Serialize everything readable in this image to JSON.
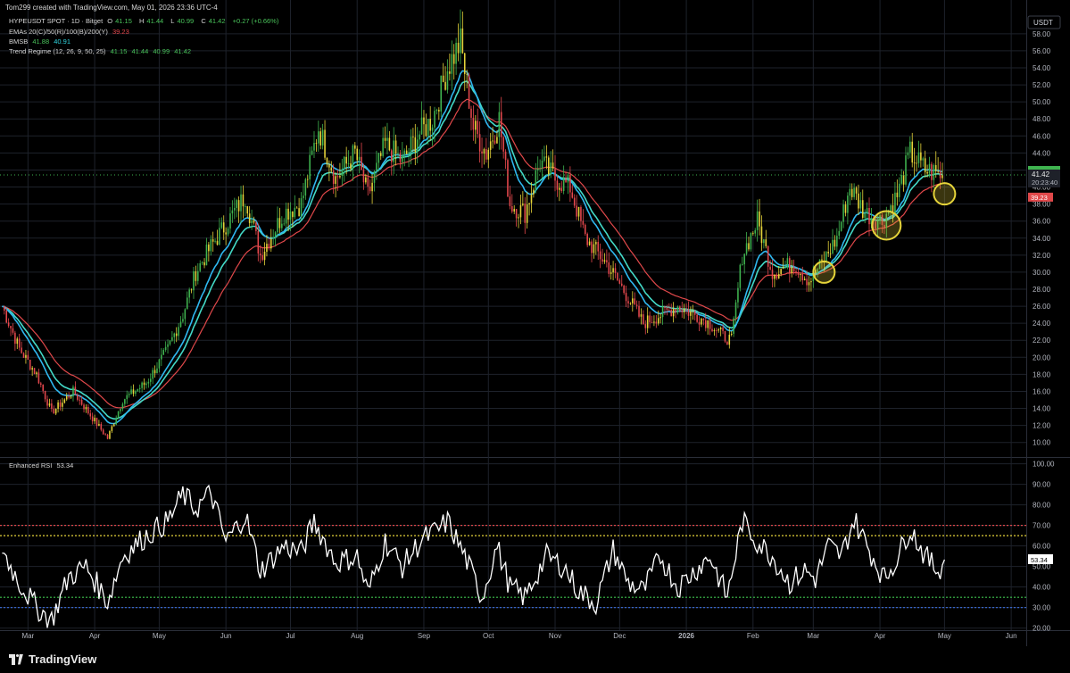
{
  "header": {
    "attribution": "Tom299 created with TradingView.com, May 01, 2026 23:36 UTC-4"
  },
  "legend": {
    "symbol": "HYPEUSDT SPOT · 1D · Bitget",
    "o_label": "O",
    "o": "41.15",
    "h_label": "H",
    "h": "41.44",
    "l_label": "L",
    "l": "40.99",
    "c_label": "C",
    "c": "41.42",
    "change": "+0.27 (+0.66%)",
    "emas_label": "EMAs 20(C)/50(R)/100(B)/200(Y)",
    "emas_value": "39.23",
    "bmsb_label": "BMSB",
    "bmsb_v1": "41.88",
    "bmsb_v2": "40.91",
    "trend_label": "Trend Regime (12, 26, 9, 50, 25)",
    "trend_v1": "41.15",
    "trend_v2": "41.44",
    "trend_v3": "40.99",
    "trend_v4": "41.42",
    "rsi_label": "Enhanced RSI",
    "rsi_value": "53.34"
  },
  "footer": {
    "brand": "TradingView"
  },
  "chart_data": [
    {
      "type": "candlestick",
      "title": "HYPEUSDT SPOT · 1D · Bitget",
      "currency": "USDT",
      "ylim": [
        8.5,
        60.5
      ],
      "yticks": [
        10.0,
        12.0,
        14.0,
        16.0,
        18.0,
        20.0,
        22.0,
        24.0,
        26.0,
        28.0,
        30.0,
        32.0,
        34.0,
        36.0,
        38.0,
        40.0,
        42.0,
        44.0,
        46.0,
        48.0,
        50.0,
        52.0,
        54.0,
        56.0,
        58.0
      ],
      "xticks": [
        "Mar",
        "Apr",
        "May",
        "Jun",
        "Jul",
        "Aug",
        "Sep",
        "Oct",
        "Nov",
        "Dec",
        "2026",
        "Feb",
        "Mar",
        "Apr",
        "May",
        "Jun"
      ],
      "x_range": [
        "2025-02-16",
        "2026-06-08"
      ],
      "last_price": 41.42,
      "last_price_time": "20:23:40",
      "ema_value_label": 39.23,
      "bmsb_value": 41.88,
      "price_keypoints": [
        [
          "2025-02-17",
          26
        ],
        [
          "2025-02-25",
          21
        ],
        [
          "2025-03-05",
          18
        ],
        [
          "2025-03-12",
          13.5
        ],
        [
          "2025-03-22",
          16
        ],
        [
          "2025-03-30",
          13.2
        ],
        [
          "2025-04-07",
          10.5
        ],
        [
          "2025-04-14",
          15
        ],
        [
          "2025-04-25",
          17
        ],
        [
          "2025-05-05",
          21
        ],
        [
          "2025-05-12",
          25
        ],
        [
          "2025-05-18",
          30
        ],
        [
          "2025-05-25",
          33
        ],
        [
          "2025-06-02",
          36
        ],
        [
          "2025-06-10",
          39
        ],
        [
          "2025-06-17",
          32
        ],
        [
          "2025-06-28",
          37
        ],
        [
          "2025-07-06",
          38
        ],
        [
          "2025-07-14",
          47
        ],
        [
          "2025-07-22",
          41
        ],
        [
          "2025-07-31",
          44
        ],
        [
          "2025-08-06",
          39
        ],
        [
          "2025-08-14",
          45
        ],
        [
          "2025-08-22",
          43
        ],
        [
          "2025-08-29",
          46
        ],
        [
          "2025-09-05",
          48
        ],
        [
          "2025-09-12",
          54
        ],
        [
          "2025-09-18",
          57
        ],
        [
          "2025-09-24",
          47
        ],
        [
          "2025-09-30",
          44
        ],
        [
          "2025-10-06",
          48
        ],
        [
          "2025-10-11",
          38
        ],
        [
          "2025-10-18",
          37
        ],
        [
          "2025-10-25",
          43
        ],
        [
          "2025-11-01",
          41
        ],
        [
          "2025-11-08",
          40
        ],
        [
          "2025-11-15",
          34
        ],
        [
          "2025-11-25",
          31
        ],
        [
          "2025-12-05",
          27
        ],
        [
          "2025-12-12",
          24
        ],
        [
          "2025-12-20",
          25
        ],
        [
          "2025-12-28",
          26
        ],
        [
          "2026-01-05",
          25
        ],
        [
          "2026-01-12",
          24
        ],
        [
          "2026-01-18",
          22.5
        ],
        [
          "2026-01-22",
          22
        ],
        [
          "2026-01-27",
          32
        ],
        [
          "2026-02-03",
          36
        ],
        [
          "2026-02-10",
          30
        ],
        [
          "2026-02-20",
          31
        ],
        [
          "2026-02-27",
          29
        ],
        [
          "2026-03-05",
          31
        ],
        [
          "2026-03-12",
          34
        ],
        [
          "2026-03-18",
          40
        ],
        [
          "2026-03-25",
          37
        ],
        [
          "2026-04-02",
          36
        ],
        [
          "2026-04-09",
          39
        ],
        [
          "2026-04-15",
          44
        ],
        [
          "2026-04-22",
          42
        ],
        [
          "2026-04-30",
          41.42
        ]
      ],
      "highlights": [
        {
          "date": "2026-03-06",
          "price": 30.0
        },
        {
          "date": "2026-04-04",
          "price": 35.5
        },
        {
          "date": "2026-05-01",
          "price": 39.2
        }
      ]
    },
    {
      "type": "line",
      "title": "Enhanced RSI",
      "ylim": [
        19,
        102
      ],
      "yticks": [
        20.0,
        30.0,
        40.0,
        50.0,
        60.0,
        70.0,
        80.0,
        90.0,
        100.0
      ],
      "levels": [
        {
          "value": 70,
          "color": "#e0484a"
        },
        {
          "value": 65,
          "color": "#e6d43a"
        },
        {
          "value": 35,
          "color": "#3ec24e"
        },
        {
          "value": 30,
          "color": "#3b6fe0"
        }
      ],
      "last_value": 53.34,
      "rsi_keypoints": [
        [
          "2025-02-17",
          58
        ],
        [
          "2025-02-25",
          42
        ],
        [
          "2025-03-05",
          30
        ],
        [
          "2025-03-12",
          24
        ],
        [
          "2025-03-20",
          45
        ],
        [
          "2025-03-28",
          50
        ],
        [
          "2025-04-07",
          33
        ],
        [
          "2025-04-14",
          55
        ],
        [
          "2025-04-25",
          65
        ],
        [
          "2025-05-05",
          72
        ],
        [
          "2025-05-12",
          85
        ],
        [
          "2025-05-18",
          78
        ],
        [
          "2025-05-25",
          86
        ],
        [
          "2025-06-01",
          62
        ],
        [
          "2025-06-10",
          75
        ],
        [
          "2025-06-17",
          48
        ],
        [
          "2025-06-28",
          60
        ],
        [
          "2025-07-06",
          57
        ],
        [
          "2025-07-12",
          72
        ],
        [
          "2025-07-22",
          52
        ],
        [
          "2025-08-01",
          55
        ],
        [
          "2025-08-06",
          37
        ],
        [
          "2025-08-14",
          62
        ],
        [
          "2025-08-22",
          50
        ],
        [
          "2025-08-31",
          63
        ],
        [
          "2025-09-08",
          68
        ],
        [
          "2025-09-12",
          72
        ],
        [
          "2025-09-20",
          55
        ],
        [
          "2025-09-28",
          35
        ],
        [
          "2025-10-05",
          60
        ],
        [
          "2025-10-11",
          40
        ],
        [
          "2025-10-18",
          35
        ],
        [
          "2025-10-28",
          55
        ],
        [
          "2025-11-05",
          50
        ],
        [
          "2025-11-12",
          38
        ],
        [
          "2025-11-20",
          32
        ],
        [
          "2025-11-28",
          58
        ],
        [
          "2025-12-05",
          42
        ],
        [
          "2025-12-12",
          38
        ],
        [
          "2025-12-20",
          55
        ],
        [
          "2025-12-28",
          40
        ],
        [
          "2026-01-05",
          48
        ],
        [
          "2026-01-12",
          55
        ],
        [
          "2026-01-20",
          35
        ],
        [
          "2026-01-27",
          72
        ],
        [
          "2026-02-03",
          62
        ],
        [
          "2026-02-10",
          55
        ],
        [
          "2026-02-18",
          42
        ],
        [
          "2026-02-25",
          48
        ],
        [
          "2026-03-02",
          44
        ],
        [
          "2026-03-08",
          60
        ],
        [
          "2026-03-14",
          55
        ],
        [
          "2026-03-20",
          73
        ],
        [
          "2026-03-28",
          56
        ],
        [
          "2026-04-03",
          44
        ],
        [
          "2026-04-09",
          54
        ],
        [
          "2026-04-15",
          69
        ],
        [
          "2026-04-22",
          55
        ],
        [
          "2026-04-28",
          48
        ],
        [
          "2026-05-01",
          53.34
        ]
      ]
    }
  ]
}
